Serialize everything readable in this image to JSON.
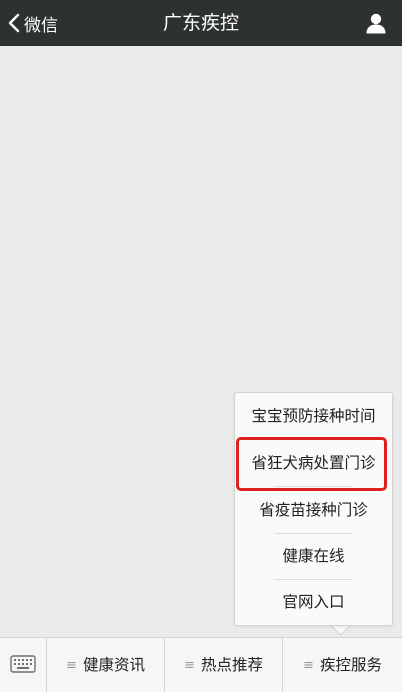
{
  "header": {
    "back_label": "微信",
    "title": "广东疾控",
    "back_icon": "chevron-left-icon",
    "profile_icon": "person-icon"
  },
  "popup_menu": {
    "items": [
      {
        "label": "宝宝预防接种时间"
      },
      {
        "label": "省狂犬病处置门诊",
        "highlighted": true
      },
      {
        "label": "省疫苗接种门诊"
      },
      {
        "label": "健康在线"
      },
      {
        "label": "官网入口"
      }
    ],
    "highlight_color": "#e02020"
  },
  "bottom_bar": {
    "keyboard_icon": "keyboard-icon",
    "menu_glyph": "≡",
    "tabs": [
      {
        "label": "健康资讯"
      },
      {
        "label": "热点推荐"
      },
      {
        "label": "疾控服务"
      }
    ]
  },
  "colors": {
    "header_bg": "#2e3132",
    "chat_bg": "#ebebeb",
    "bar_bg": "#f6f6f6"
  }
}
